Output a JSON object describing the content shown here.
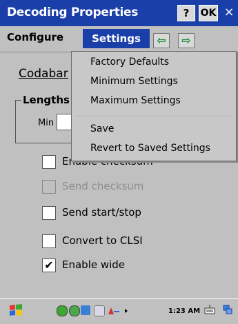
{
  "window": {
    "title": "Decoding Properties"
  },
  "titlebar": {
    "help_label": "?",
    "ok_label": "OK",
    "close_label": "×"
  },
  "menubar": {
    "configure": "Configure",
    "settings": "Settings",
    "arrow_left": "⇦",
    "arrow_right": "⇨"
  },
  "settings_menu": {
    "items": [
      "Factory Defaults",
      "Minimum Settings",
      "Maximum Settings",
      "Save",
      "Revert to Saved Settings"
    ]
  },
  "page": {
    "symbology": "Codabar",
    "lengths_label": "Lengths",
    "min_label": "Min",
    "min_value": ""
  },
  "options": [
    {
      "label": "Enable checksum",
      "checked": false,
      "enabled": true
    },
    {
      "label": "Send checksum",
      "checked": false,
      "enabled": false
    },
    {
      "label": "Send start/stop",
      "checked": false,
      "enabled": true
    },
    {
      "label": "Convert to CLSI",
      "checked": false,
      "enabled": true
    },
    {
      "label": "Enable wide",
      "checked": true,
      "enabled": true
    }
  ],
  "taskbar": {
    "clock": "1:23 AM"
  },
  "colors": {
    "title_blue": "#1a3fa8",
    "chrome_gray": "#c0c0c0",
    "arrow_green": "#1a8f3a"
  }
}
